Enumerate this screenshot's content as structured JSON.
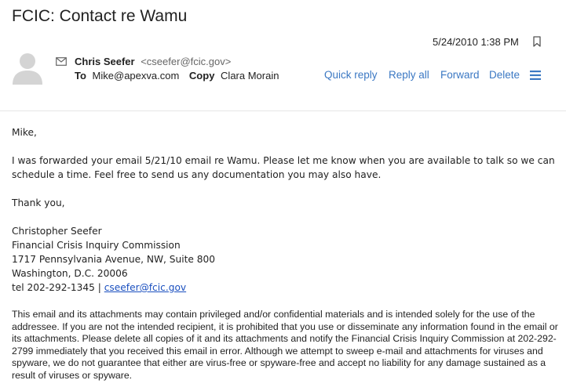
{
  "subject": "FCIC: Contact re Wamu",
  "date": "5/24/2010 1:38 PM",
  "sender": {
    "name": "Chris Seefer",
    "email": "<cseefer@fcic.gov>"
  },
  "recipients": {
    "to_label": "To",
    "to": "Mike@apexva.com",
    "copy_label": "Copy",
    "copy": "Clara Morain"
  },
  "actions": {
    "quick_reply": "Quick reply",
    "reply_all": "Reply all",
    "forward": "Forward",
    "delete": "Delete"
  },
  "icons": {
    "bookmark": "bookmark-icon",
    "avatar": "avatar",
    "envelope": "envelope-icon",
    "menu": "hamburger-menu-icon"
  },
  "colors": {
    "link": "#3b78c3",
    "email_link": "#1a4fbf",
    "muted": "#666666"
  },
  "body": {
    "greeting": "Mike,",
    "para1_line1": "I was forwarded your email 5/21/10 email re Wamu. Please let me know when you are available to talk so we can",
    "para1_line2": "schedule a time.  Feel free to send us any documentation you may also have.",
    "closing": "Thank you,",
    "sig_name": "Christopher Seefer",
    "sig_org": "Financial Crisis Inquiry Commission",
    "sig_address1": "1717 Pennsylvania Avenue, NW, Suite 800",
    "sig_address2": "Washington, D.C. 20006",
    "sig_tel": "tel 202-292-1345 | ",
    "sig_email": "cseefer@fcic.gov"
  },
  "disclaimer": "This email and its attachments may contain privileged and/or confidential materials and is intended solely for the use of the addressee. If you are not the intended recipient, it is prohibited that you use or disseminate any information found in the email or its attachments. Please delete all copies of it and its attachments and notify the Financial Crisis Inquiry Commission at 202-292-2799 immediately that you received this email in error. Although we attempt to sweep e-mail and attachments for viruses and spyware, we do not guarantee that either are virus-free or spyware-free and accept no liability for any damage sustained as a result of viruses or spyware."
}
